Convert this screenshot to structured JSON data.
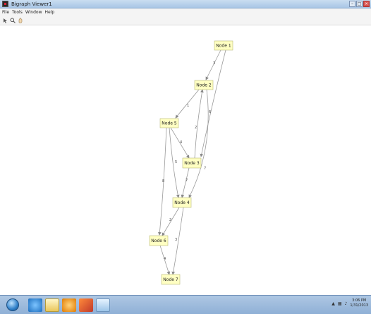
{
  "window": {
    "title": "Bigraph Viewer1"
  },
  "menu": {
    "items": [
      "File",
      "Tools",
      "Window",
      "Help"
    ]
  },
  "toolbar": {
    "tools": [
      "select-icon",
      "zoom-icon",
      "pan-hand-icon"
    ]
  },
  "graph": {
    "nodes": [
      "Node 1",
      "Node 2",
      "Node 5",
      "Node 3",
      "Node 4",
      "Node 6",
      "Node 7"
    ],
    "edge_labels": [
      "3",
      "1",
      "6",
      "2",
      "4",
      "5",
      "7",
      "7",
      "8",
      "2",
      "3",
      "4"
    ]
  },
  "taskbar": {
    "apps": [
      "windows-explorer-icon",
      "internet-explorer-icon",
      "file-folder-icon",
      "media-player-icon",
      "matlab-icon",
      "paint-icon"
    ]
  },
  "clock": {
    "time": "3:06 PM",
    "date": "1/31/2013"
  }
}
